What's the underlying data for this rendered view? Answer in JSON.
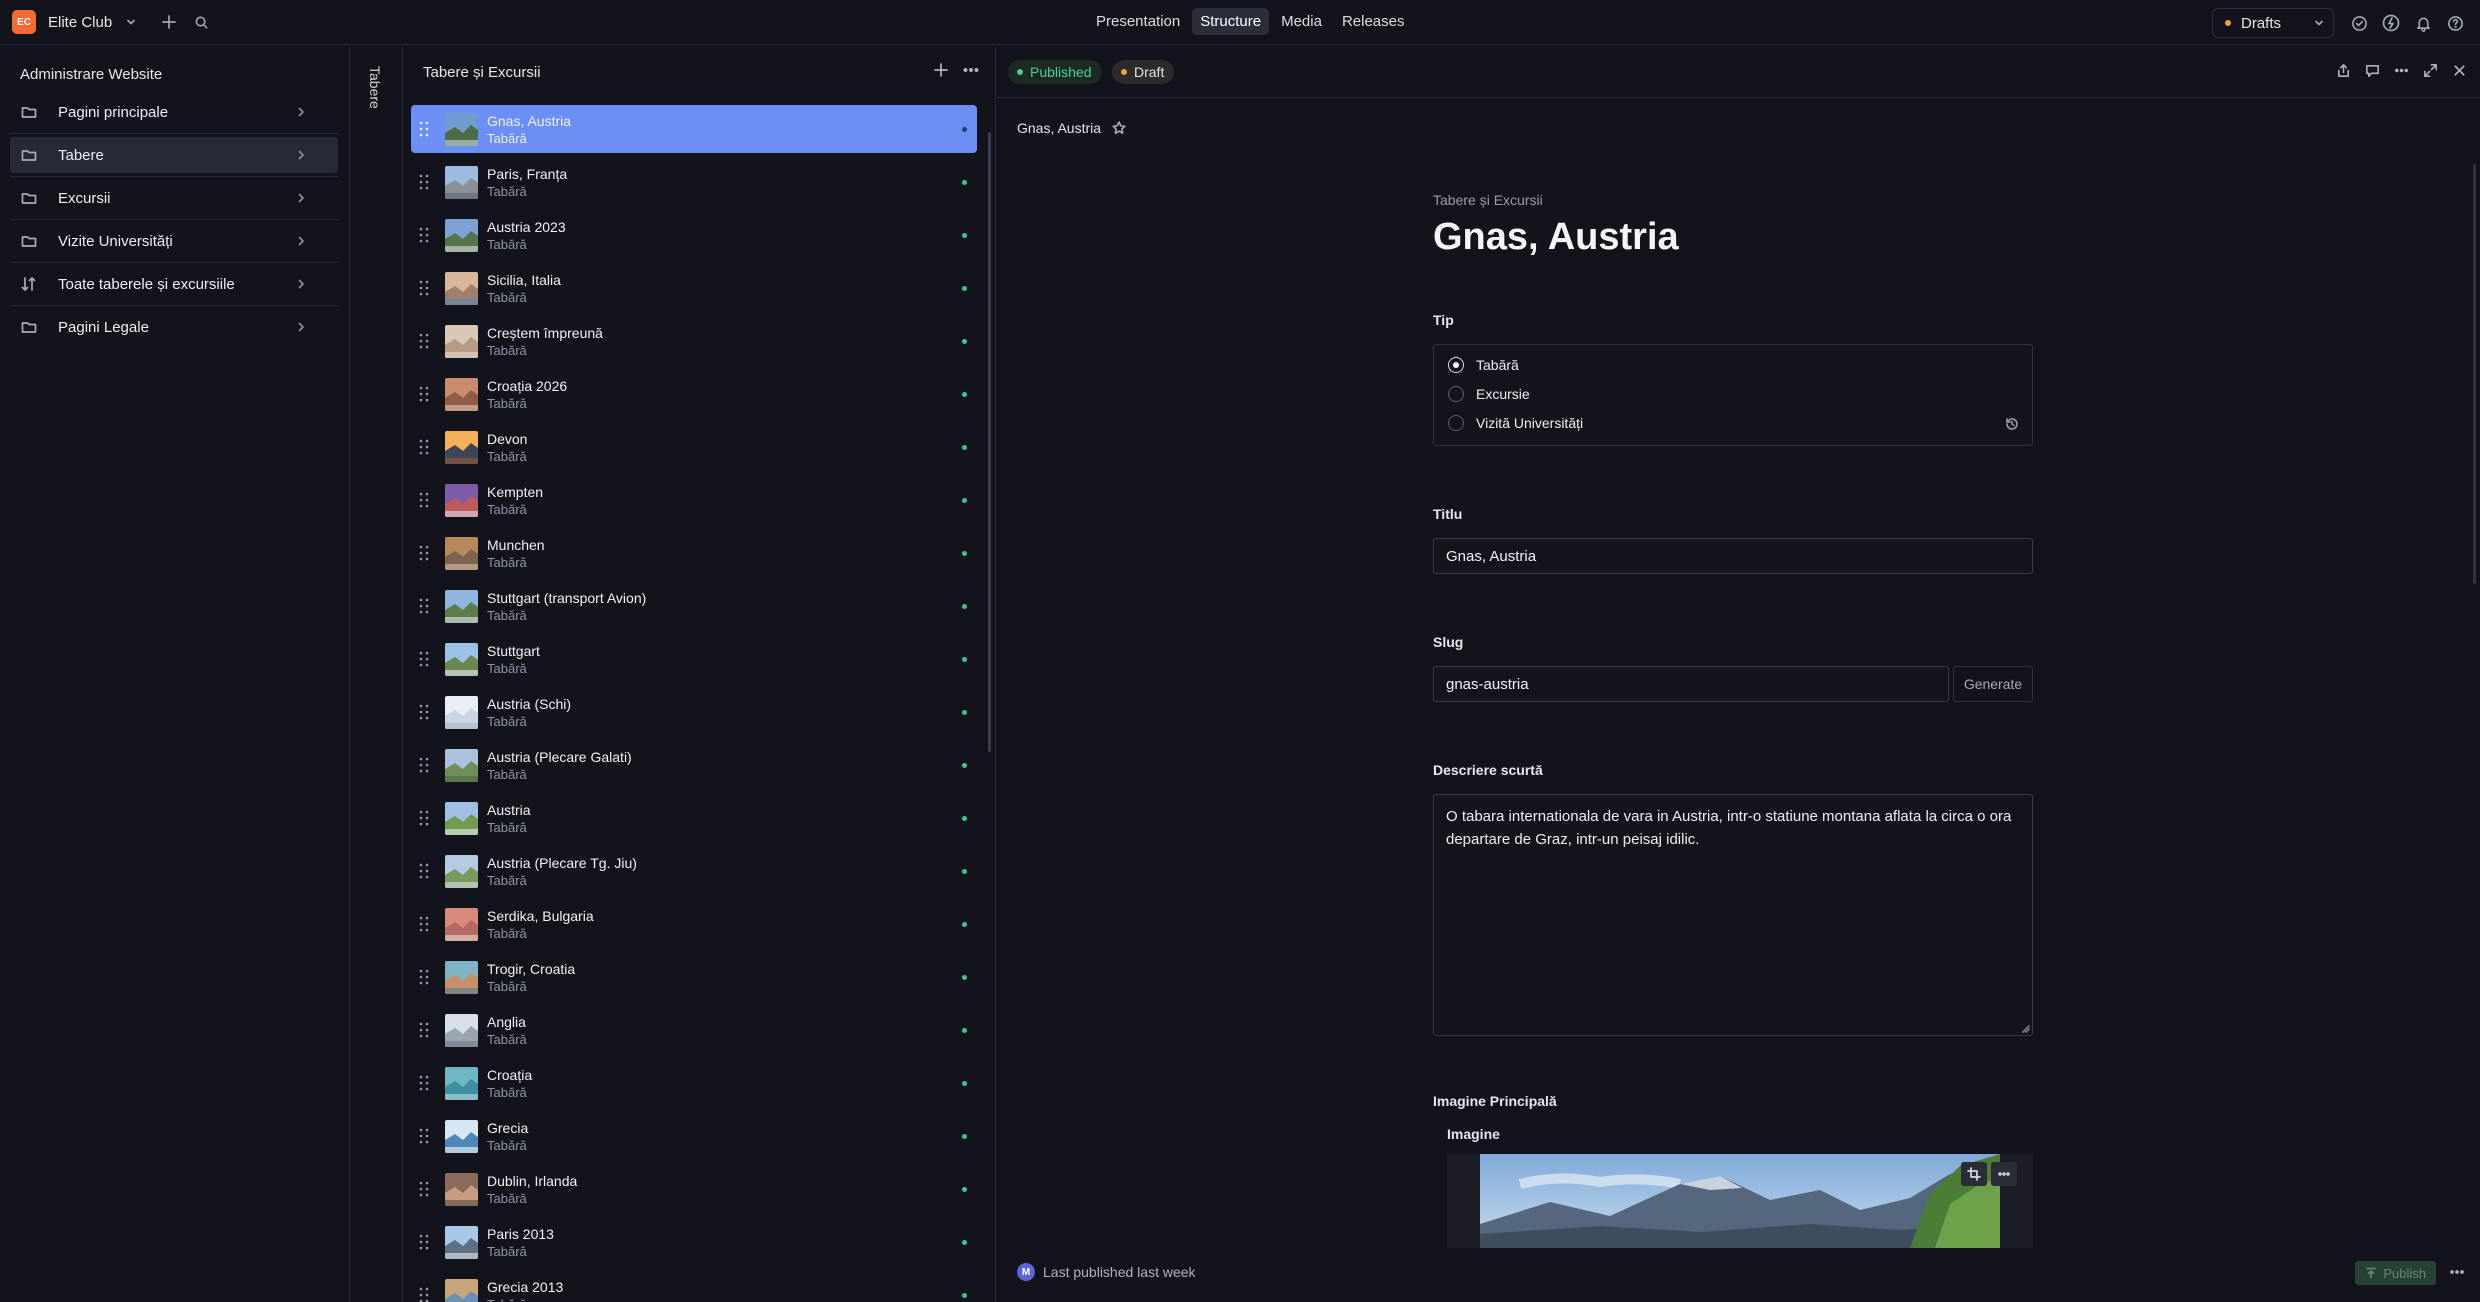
{
  "workspace": {
    "initials": "EC",
    "name": "Elite Club"
  },
  "topnav": {
    "items": [
      "Presentation",
      "Structure",
      "Media",
      "Releases"
    ],
    "active": "Structure"
  },
  "perspective": {
    "label": "Drafts"
  },
  "colors": {
    "accent_selected": "#6c8ff5",
    "published_green": "#37c985",
    "draft_orange": "#f0a33a",
    "brand_orange": "#f36a36"
  },
  "structure": {
    "title": "Administrare Website",
    "items": [
      {
        "label": "Pagini principale",
        "icon": "folder-icon"
      },
      {
        "label": "Tabere",
        "icon": "folder-icon"
      },
      {
        "label": "Excursii",
        "icon": "folder-icon"
      },
      {
        "label": "Vizite Universități",
        "icon": "folder-icon"
      },
      {
        "label": "Toate taberele și excursiile",
        "icon": "sort-icon"
      },
      {
        "label": "Pagini Legale",
        "icon": "folder-icon"
      }
    ]
  },
  "tabstrip": {
    "label": "Tabere"
  },
  "list": {
    "title": "Tabere și Excursii",
    "items": [
      {
        "title": "Gnas, Austria",
        "type": "Tabără"
      },
      {
        "title": "Paris, Franța",
        "type": "Tabără"
      },
      {
        "title": "Austria 2023",
        "type": "Tabără"
      },
      {
        "title": "Sicilia, Italia",
        "type": "Tabără"
      },
      {
        "title": "Creștem împreună",
        "type": "Tabără"
      },
      {
        "title": "Croația 2026",
        "type": "Tabără"
      },
      {
        "title": "Devon",
        "type": "Tabără"
      },
      {
        "title": "Kempten",
        "type": "Tabără"
      },
      {
        "title": "Munchen",
        "type": "Tabără"
      },
      {
        "title": "Stuttgart (transport Avion)",
        "type": "Tabără"
      },
      {
        "title": "Stuttgart",
        "type": "Tabără"
      },
      {
        "title": "Austria (Schi)",
        "type": "Tabără"
      },
      {
        "title": "Austria (Plecare Galati)",
        "type": "Tabără"
      },
      {
        "title": "Austria",
        "type": "Tabără"
      },
      {
        "title": "Austria (Plecare Tg. Jiu)",
        "type": "Tabără"
      },
      {
        "title": "Serdika, Bulgaria",
        "type": "Tabără"
      },
      {
        "title": "Trogir, Croatia",
        "type": "Tabără"
      },
      {
        "title": "Anglia",
        "type": "Tabără"
      },
      {
        "title": "Croația",
        "type": "Tabără"
      },
      {
        "title": "Grecia",
        "type": "Tabără"
      },
      {
        "title": "Dublin, Irlanda",
        "type": "Tabără"
      },
      {
        "title": "Paris 2013",
        "type": "Tabără"
      },
      {
        "title": "Grecia 2013",
        "type": "Tabără"
      }
    ]
  },
  "editor": {
    "status_published": "Published",
    "status_draft": "Draft",
    "header_title": "Gnas, Austria",
    "doc_type": "Tabere și Excursii",
    "title": "Gnas, Austria",
    "tip": {
      "label": "Tip",
      "options": [
        "Tabără",
        "Excursie",
        "Vizită Universități"
      ],
      "selected": "Tabără"
    },
    "titlu": {
      "label": "Titlu",
      "value": "Gnas, Austria"
    },
    "slug": {
      "label": "Slug",
      "value": "gnas-austria",
      "button": "Generate"
    },
    "descriere": {
      "label": "Descriere scurtă",
      "value": "O tabara internationala de vara in Austria, intr-o statiune montana aflata la circa o ora departare de Graz, intr-un peisaj idilic."
    },
    "imagine_principala": {
      "label": "Imagine Principală",
      "sub_label": "Imagine"
    }
  },
  "footer": {
    "avatar": "M",
    "last_published": "Last published last week",
    "publish_button": "Publish"
  }
}
